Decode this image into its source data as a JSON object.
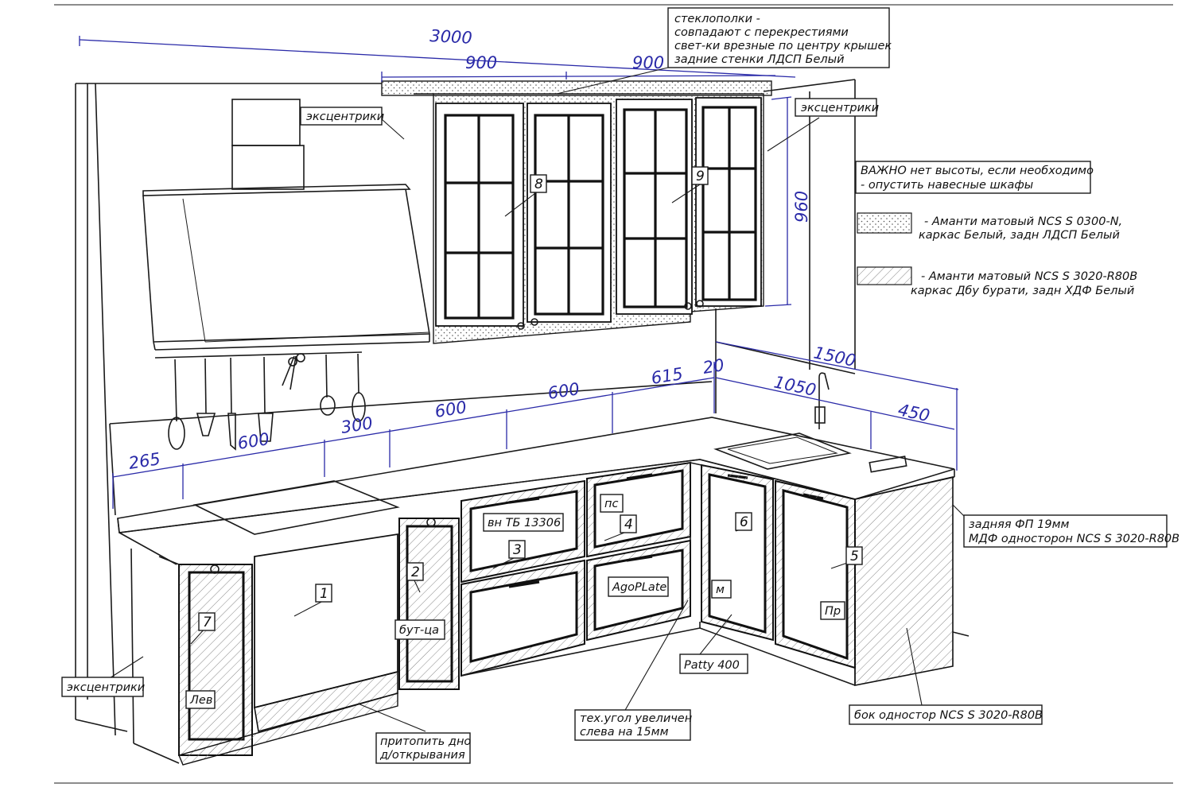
{
  "dimensions": {
    "overall_width": "3000",
    "upper_left_width": "900",
    "upper_right_width": "900",
    "upper_height": "960",
    "base_265": "265",
    "base_600_a": "600",
    "base_300": "300",
    "base_600_b": "600",
    "base_600_c": "600",
    "base_615": "615",
    "gap_20": "20",
    "side_1500": "1500",
    "side_1050": "1050",
    "side_450": "450"
  },
  "notes": {
    "glass_shelves": [
      "стеклополки -",
      "совпадают с перекрестиями",
      "свет-ки врезные по центру крышек",
      "задние стенки ЛДСП Белый"
    ],
    "eccentrics_top_left": "эксцентрики",
    "eccentrics_top_right": "эксцентрики",
    "eccentrics_bottom_left": "эксцентрики",
    "important": [
      "ВАЖНО нет высоты, если необходимо",
      "- опустить навесные шкафы"
    ],
    "legend_dots": [
      "- Аманти матовый NCS S 0300-N,",
      "каркас Белый, задн ЛДСП Белый"
    ],
    "legend_hatch": [
      "- Аманти матовый NCS S 3020-R80B",
      "каркас Дбу бурати, задн ХДФ Белый"
    ],
    "back_panel": [
      "задняя ФП 19мм",
      "МДФ односторон NCS S 3020-R80B"
    ],
    "side_panel": "бок одностор NCS S 3020-R80B",
    "tech_corner": [
      "тех.угол увеличен",
      "слева на 15мм"
    ],
    "bottom_lower": [
      "притопить дно",
      "д/открывания"
    ],
    "patty": "Patty 400",
    "bottle": "бут-ца",
    "inner_tb": "вн ТБ 13306",
    "agoplate": "AgoPLate",
    "ps": "пс",
    "m": "м",
    "pr": "Пр",
    "lev": "Лев"
  },
  "tags": [
    "1",
    "2",
    "3",
    "4",
    "5",
    "6",
    "7",
    "8",
    "9"
  ]
}
